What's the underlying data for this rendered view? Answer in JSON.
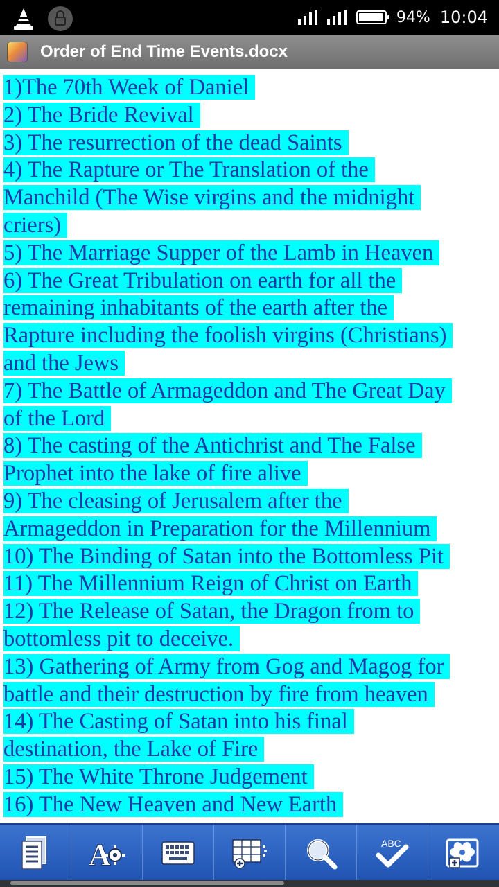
{
  "status_bar": {
    "battery_percent_text": "94%",
    "battery_level": 0.94,
    "time": "10:04",
    "icons": [
      "vlc-icon",
      "lock-icon",
      "signal-icon",
      "signal-icon",
      "battery-icon"
    ]
  },
  "title_bar": {
    "app_icon": "document-app-icon",
    "title": "Order of End Time Events.docx"
  },
  "document": {
    "highlight_color": "#00ffff",
    "text_color": "#1c3aa8",
    "lines": [
      "1)The 70th Week of Daniel",
      "2) The Bride Revival",
      "3) The resurrection of the dead Saints",
      "4) The Rapture or The Translation of the",
      "Manchild (The Wise virgins and the midnight",
      "criers)",
      "5) The Marriage Supper of the Lamb in Heaven",
      "6) The Great Tribulation on earth for all the",
      "remaining inhabitants of the earth after the",
      "Rapture including the foolish virgins (Christians)",
      "and the Jews",
      "7) The Battle of Armageddon and The Great Day",
      "of the Lord",
      "8) The casting of the Antichrist and The False",
      "Prophet into the lake of fire alive",
      "9) The cleasing of Jerusalem after the",
      "Armageddon in Preparation for the Millennium",
      "10) The Binding of Satan into the Bottomless Pit",
      "11) The Millennium Reign of Christ on Earth",
      "12) The Release of Satan, the Dragon from to",
      "bottomless pit to deceive.",
      "13) Gathering of Army from Gog and Magog for",
      "battle and their destruction by fire from heaven",
      "14) The Casting of Satan into his final",
      "destination, the Lake of Fire",
      "15) The White Throne Judgement",
      "16) The New Heaven and New Earth"
    ]
  },
  "toolbar": {
    "background_color": "#2a5cbf",
    "spellcheck_label": "ABC",
    "buttons": [
      {
        "name": "document-view-button",
        "icon": "document-icon"
      },
      {
        "name": "text-format-button",
        "icon": "font-settings-icon"
      },
      {
        "name": "keyboard-button",
        "icon": "keyboard-icon"
      },
      {
        "name": "insert-table-button",
        "icon": "table-insert-icon"
      },
      {
        "name": "search-button",
        "icon": "magnifier-icon"
      },
      {
        "name": "spellcheck-button",
        "icon": "spellcheck-icon"
      },
      {
        "name": "insert-image-button",
        "icon": "insert-picture-icon"
      }
    ]
  }
}
